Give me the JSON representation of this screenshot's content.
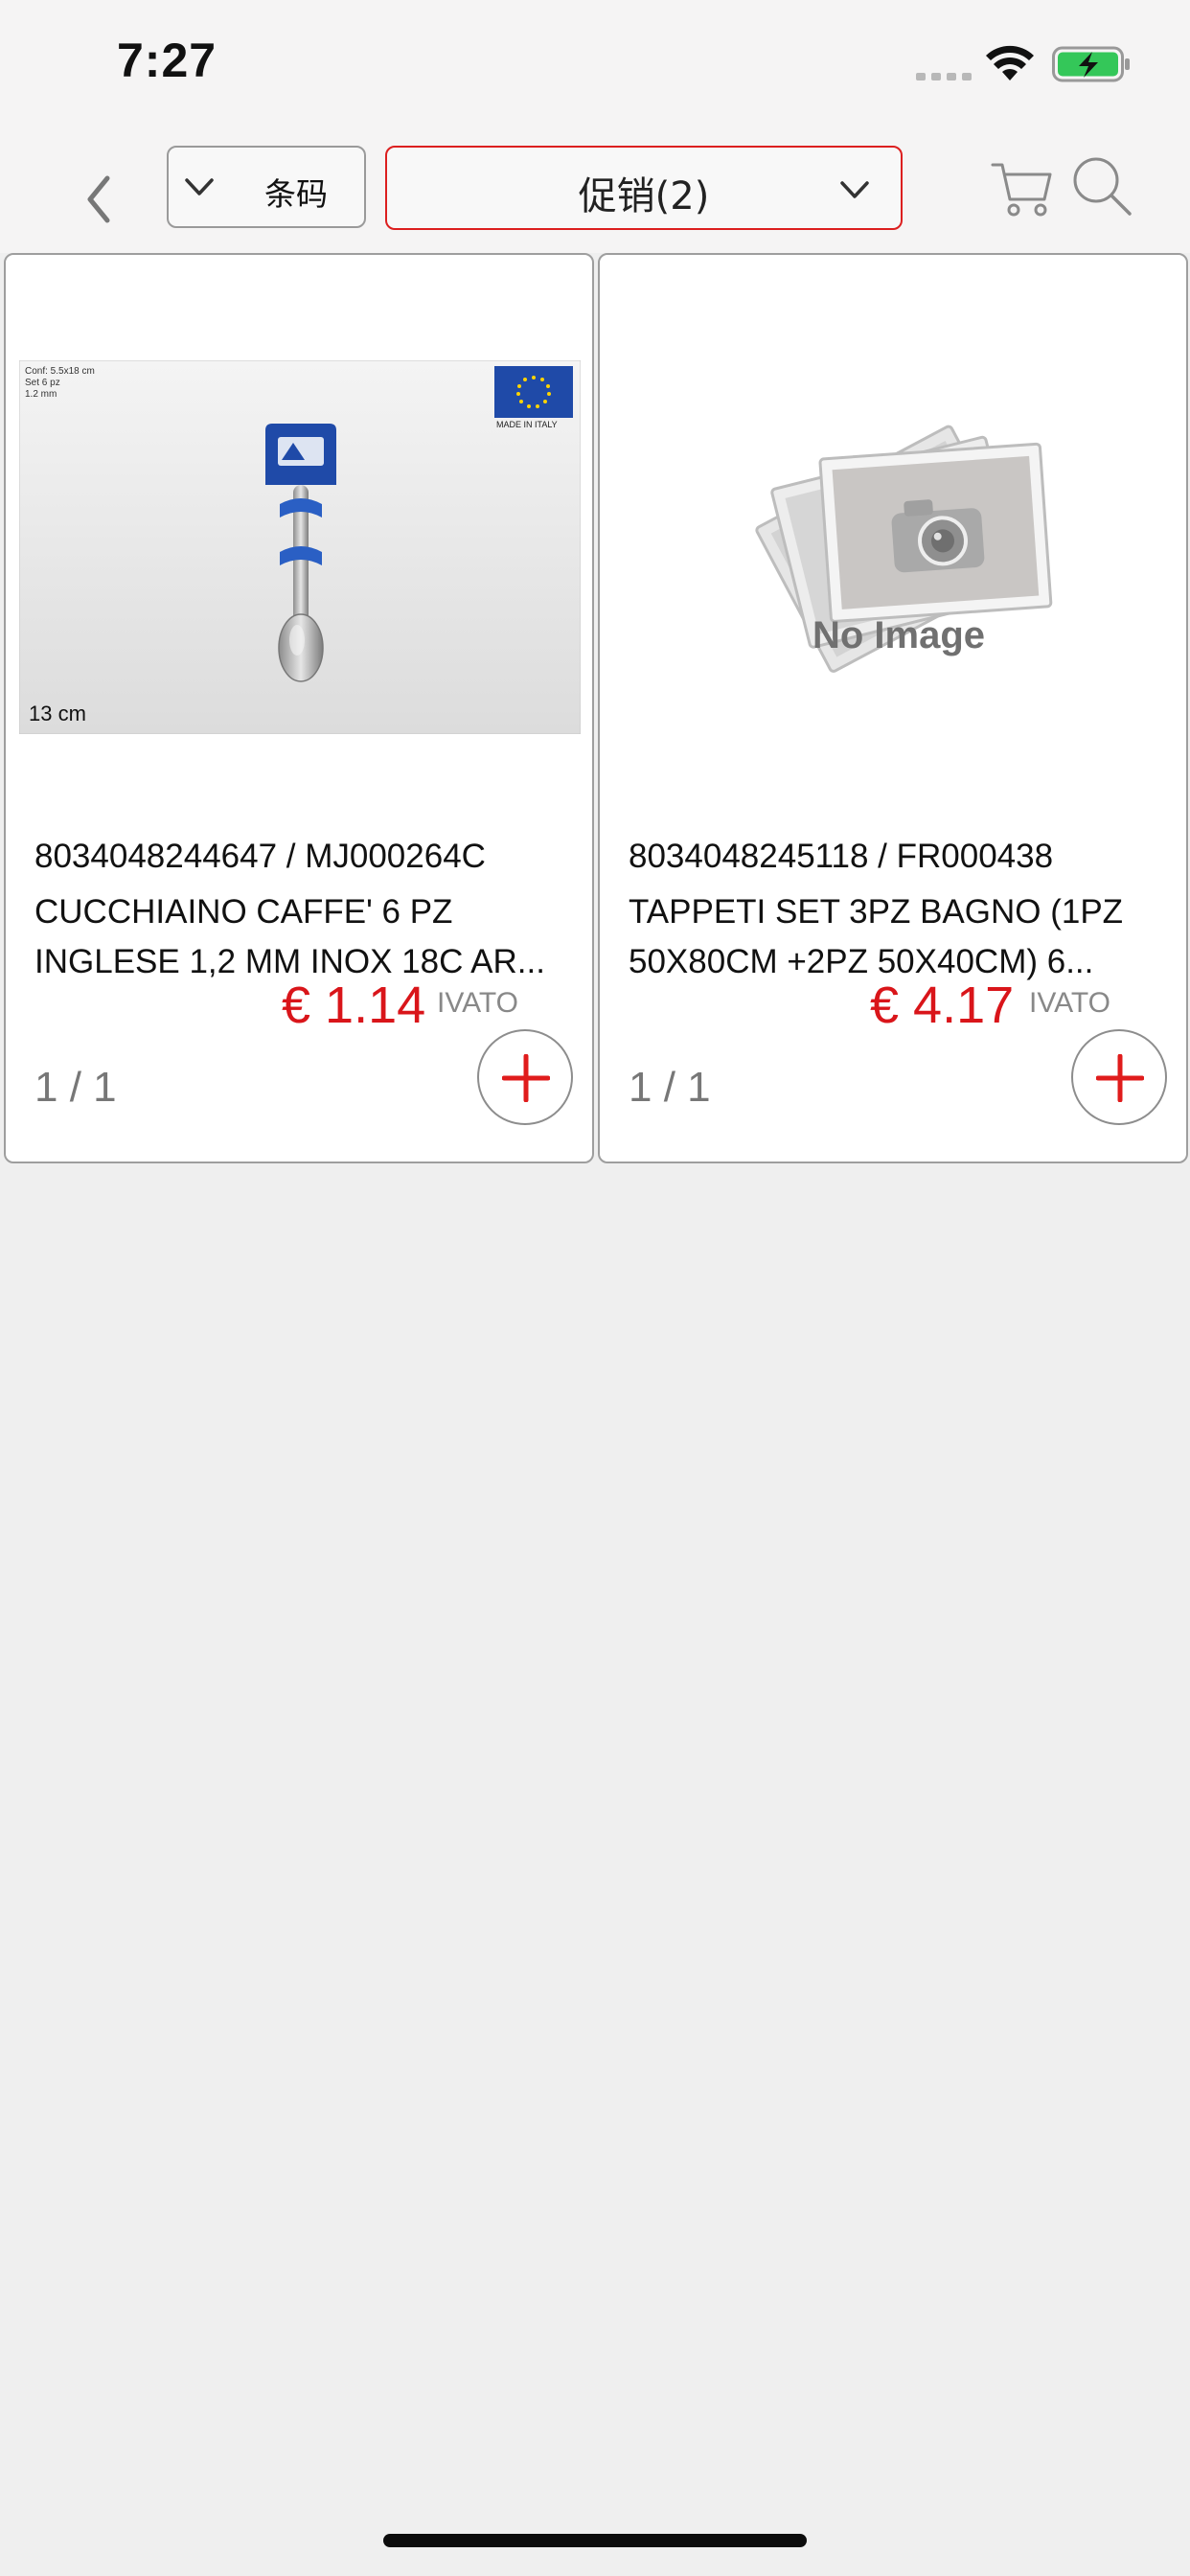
{
  "status_bar": {
    "time": "7:27"
  },
  "toolbar": {
    "field_label": "条码",
    "filter_label": "促销(2)"
  },
  "products": [
    {
      "code": "8034048244647 / MJ000264C",
      "description": "CUCCHIAINO CAFFE' 6 PZ INGLESE 1,2 MM INOX 18C AR...",
      "price": "€ 1.14",
      "tax_label": "IVATO",
      "pager": "1 / 1",
      "image": {
        "conf_lines": [
          "Conf: 5.5x18 cm",
          "Set 6 pz",
          "1.2 mm"
        ],
        "made_in": "MADE IN ITALY",
        "size": "13 cm"
      }
    },
    {
      "code": "8034048245118 / FR000438",
      "description": "TAPPETI SET 3PZ BAGNO (1PZ 50X80CM +2PZ 50X40CM) 6...",
      "price": "€ 4.17",
      "tax_label": "IVATO",
      "pager": "1 / 1",
      "image": {
        "placeholder_text": "No Image"
      }
    }
  ],
  "colors": {
    "accent": "#d9151a",
    "background": "#efefef",
    "battery": "#34c759"
  }
}
